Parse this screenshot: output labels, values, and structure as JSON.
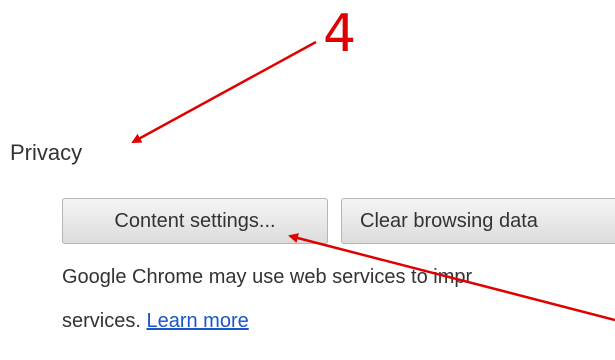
{
  "annotation": {
    "step_number": "4",
    "arrow_color": "#e00000"
  },
  "privacy": {
    "title": "Privacy",
    "content_settings_label": "Content settings...",
    "clear_browsing_label": "Clear browsing data",
    "description_line1": "Google Chrome may use web services to impr",
    "description_line2_prefix": "services.",
    "learn_more_label": "Learn more",
    "link_color": "#1a55cc"
  }
}
